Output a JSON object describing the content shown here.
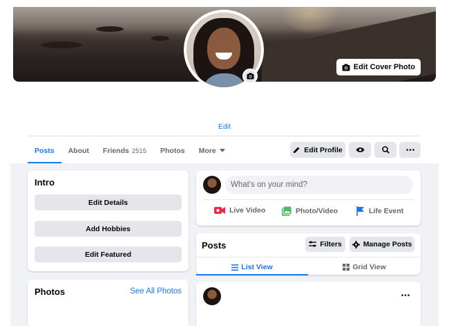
{
  "cover": {
    "edit_label": "Edit Cover Photo",
    "icon": "camera-icon"
  },
  "profile": {
    "edit_link": "Edit"
  },
  "tabs": [
    {
      "label": "Posts",
      "active": true
    },
    {
      "label": "About"
    },
    {
      "label": "Friends",
      "count": "2515"
    },
    {
      "label": "Photos"
    },
    {
      "label": "More",
      "icon": "caret-down-icon"
    }
  ],
  "actions": {
    "edit_profile": "Edit Profile",
    "view_as_icon": "eye-icon",
    "search_icon": "search-icon",
    "more_icon": "ellipsis-icon"
  },
  "intro": {
    "title": "Intro",
    "buttons": [
      "Edit Details",
      "Add Hobbies",
      "Edit Featured"
    ]
  },
  "photos": {
    "title": "Photos",
    "see_all": "See All Photos"
  },
  "composer": {
    "placeholder": "What's on your mind?",
    "actions": [
      {
        "label": "Live Video",
        "icon": "live-video-icon",
        "color": "#f02849"
      },
      {
        "label": "Photo/Video",
        "icon": "photo-icon",
        "color": "#45bd62"
      },
      {
        "label": "Life Event",
        "icon": "flag-icon",
        "color": "#1877f2"
      }
    ]
  },
  "posts": {
    "title": "Posts",
    "filters": "Filters",
    "manage": "Manage Posts",
    "views": [
      {
        "label": "List View",
        "icon": "list-icon",
        "active": true
      },
      {
        "label": "Grid View",
        "icon": "grid-icon"
      }
    ]
  },
  "post": {
    "more_icon": "ellipsis-icon"
  },
  "colors": {
    "accent": "#1877f2",
    "page_bg": "#f0f2f5",
    "button_bg": "#e4e6eb"
  }
}
